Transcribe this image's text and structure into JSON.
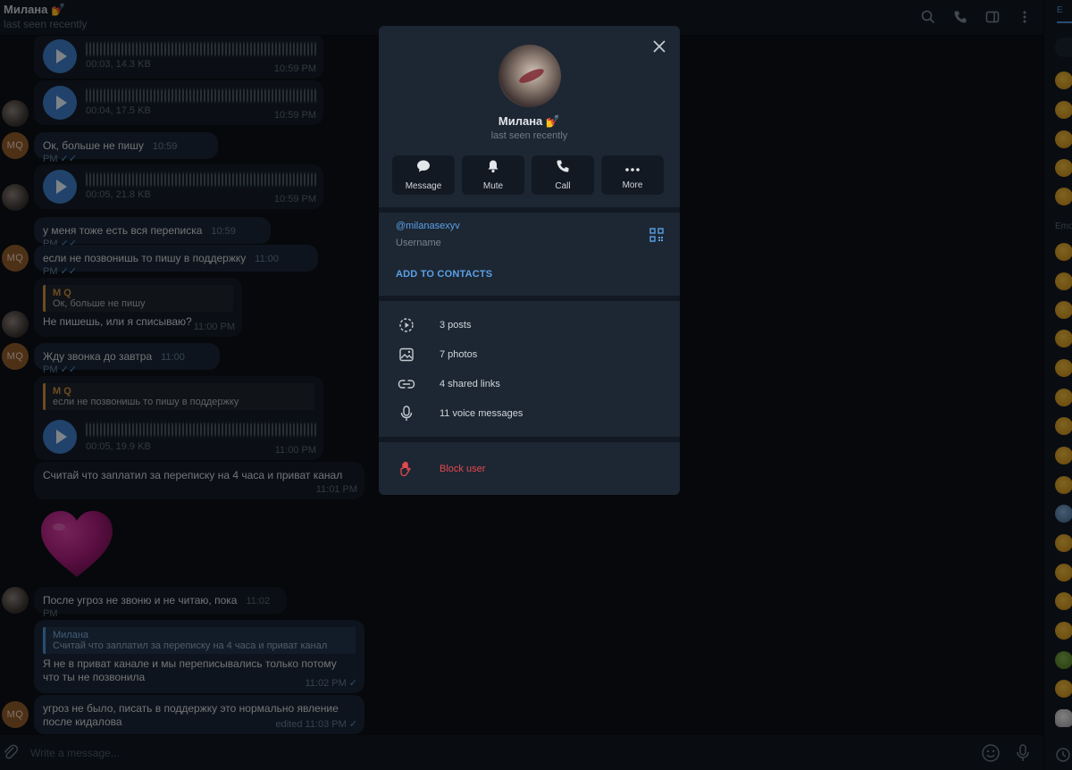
{
  "header": {
    "name": "Милана",
    "name_emoji": "💅",
    "status": "last seen recently",
    "icons": [
      "search-icon",
      "phone-icon",
      "sidebar-toggle-icon",
      "more-vertical-icon"
    ]
  },
  "messages": {
    "voice1": {
      "meta": "00:03, 14.3 KB",
      "time": "10:59 PM"
    },
    "voice2": {
      "meta": "00:04, 17.5 KB",
      "time": "10:59 PM"
    },
    "msg1": {
      "text": "Ок, больше не пишу",
      "time": "10:59 PM"
    },
    "voice3": {
      "meta": "00:05, 21.8 KB",
      "time": "10:59 PM"
    },
    "msg2": {
      "text": "у меня тоже есть вся переписка",
      "time": "10:59 PM"
    },
    "msg3": {
      "text": "если не позвонишь то пишу в поддержку",
      "time": "11:00 PM"
    },
    "msg4": {
      "reply_name": "M Q",
      "reply_text": "Ок, больше не пишу",
      "text": "Не пишешь, или я списываю?",
      "time": "11:00 PM"
    },
    "msg5": {
      "text": "Жду звонка до завтра",
      "time": "11:00 PM"
    },
    "msg6": {
      "reply_name": "M Q",
      "reply_text": "если не позвонишь то пишу в поддержку",
      "meta": "00:05, 19.9 KB",
      "time": "11:00 PM"
    },
    "msg7": {
      "text": "Считай что заплатил за переписку на 4 часа и приват канал",
      "time": "11:01 PM"
    },
    "msg8": {
      "text": "После угроз не звоню и не читаю, пока",
      "time": "11:02 PM"
    },
    "msg9": {
      "reply_name": "Милана",
      "reply_text": "Считай что заплатил за переписку на 4 часа и приват канал",
      "text": "Я не в приват канале и мы переписывались только потому что ты не позвонила",
      "time": "11:02 PM"
    },
    "msg10": {
      "text": "угроз не было, писать в поддержку это нормально явление после кидалова",
      "time": "edited 11:03 PM"
    }
  },
  "avatar_initials": "MQ",
  "composer": {
    "placeholder": "Write a message..."
  },
  "emoji_panel": {
    "section": "Emo"
  },
  "profile": {
    "name": "Милана",
    "name_emoji": "💅",
    "status": "last seen recently",
    "actions": [
      {
        "label": "Message",
        "icon": "message-icon"
      },
      {
        "label": "Mute",
        "icon": "bell-icon"
      },
      {
        "label": "Call",
        "icon": "phone-icon"
      },
      {
        "label": "More",
        "icon": "more-icon"
      }
    ],
    "username": "@milanasexyv",
    "username_label": "Username",
    "add_contacts": "ADD TO CONTACTS",
    "media": [
      {
        "label": "3 posts",
        "icon": "posts-icon"
      },
      {
        "label": "7 photos",
        "icon": "photo-icon"
      },
      {
        "label": "4 shared links",
        "icon": "link-icon"
      },
      {
        "label": "11 voice messages",
        "icon": "mic-icon"
      }
    ],
    "block": "Block user"
  },
  "colors": {
    "accent": "#5aa0e6",
    "danger": "#e5484d",
    "bubble_out": "#1b2636",
    "bubble_in": "#141c27"
  }
}
